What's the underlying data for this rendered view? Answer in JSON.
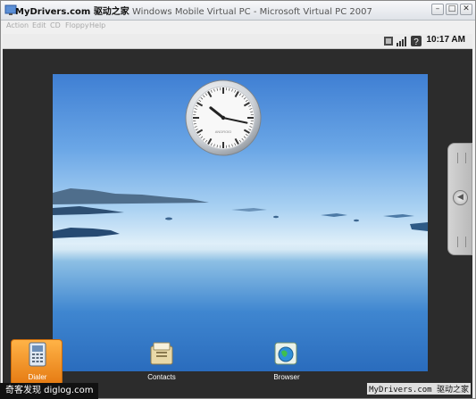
{
  "window": {
    "title": "Windows Mobile Virtual PC - Microsoft Virtual PC 2007",
    "title_watermark": "MyDrivers.com 驱动之家",
    "controls": [
      "minimize",
      "maximize",
      "close"
    ]
  },
  "menu": {
    "items": [
      "Action",
      "Edit",
      "CD",
      "Floppy",
      "Help"
    ]
  },
  "status_bar": {
    "time": "10:17 AM",
    "icons": [
      "sim-card-icon",
      "signal-strength-icon",
      "help-icon"
    ]
  },
  "home": {
    "clock": {
      "hour": 10,
      "minute": 17,
      "brand": "ANDROID"
    },
    "wallpaper": "lake-and-sky",
    "dock": [
      {
        "label": "Dialer",
        "icon": "dialer-icon",
        "selected": true
      },
      {
        "label": "Contacts",
        "icon": "contacts-icon",
        "selected": false
      },
      {
        "label": "Browser",
        "icon": "browser-globe-icon",
        "selected": false
      }
    ]
  },
  "watermarks": {
    "bottom_left": "奇客发现 diglog.com",
    "bottom_right": "MyDrivers.com 驱动之家"
  },
  "colors": {
    "accent_orange": "#f0901c",
    "device_frame": "#2c2c2c",
    "sky_top": "#3f7fd3",
    "water_bottom": "#2a6cbd"
  }
}
